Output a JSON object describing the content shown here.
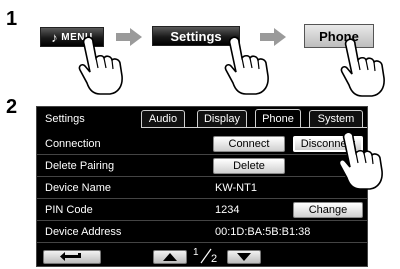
{
  "steps": {
    "step1_number": "1",
    "step2_number": "2",
    "menu_label": "MENU",
    "settings_label": "Settings",
    "phone_label": "Phone"
  },
  "screen": {
    "title": "Settings",
    "tabs": [
      {
        "label": "Audio",
        "active": false
      },
      {
        "label": "Display",
        "active": false
      },
      {
        "label": "Phone",
        "active": true
      },
      {
        "label": "System",
        "active": false
      }
    ],
    "rows": [
      {
        "label": "Connection"
      },
      {
        "label": "Delete Pairing"
      },
      {
        "label": "Device Name",
        "value": "KW-NT1"
      },
      {
        "label": "PIN Code",
        "value": "1234"
      },
      {
        "label": "Device Address",
        "value": "00:1D:BA:5B:B1:38"
      }
    ],
    "buttons": {
      "connect": "Connect",
      "disconnect": "Disconnect",
      "delete": "Delete",
      "change": "Change"
    },
    "pagination": {
      "current": "1",
      "total": "2"
    }
  },
  "colors": {
    "screen_bg": "#000000",
    "hw_button": "#1a1a1a",
    "text_light": "#ffffff"
  },
  "icons": {
    "note": "music-note-icon",
    "arrow": "right-arrow-icon",
    "hand": "pointing-hand-icon",
    "back": "back-arrow-icon",
    "up": "triangle-up-icon",
    "down": "triangle-down-icon"
  }
}
